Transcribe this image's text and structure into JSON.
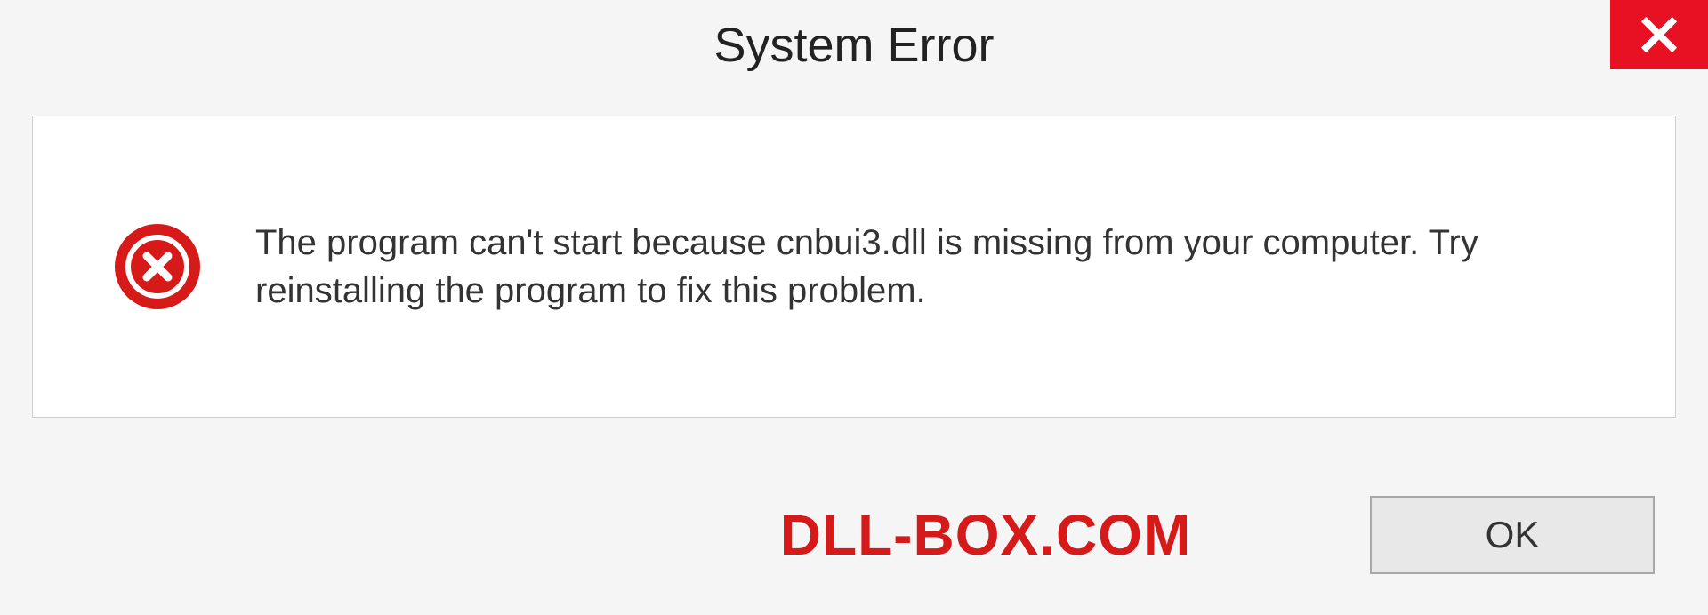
{
  "dialog": {
    "title": "System Error",
    "message": "The program can't start because cnbui3.dll is missing from your computer. Try reinstalling the program to fix this problem.",
    "ok_label": "OK"
  },
  "watermark": "DLL-BOX.COM",
  "colors": {
    "close_bg": "#e81123",
    "error_icon": "#d61a1a",
    "watermark": "#d61a1a"
  }
}
